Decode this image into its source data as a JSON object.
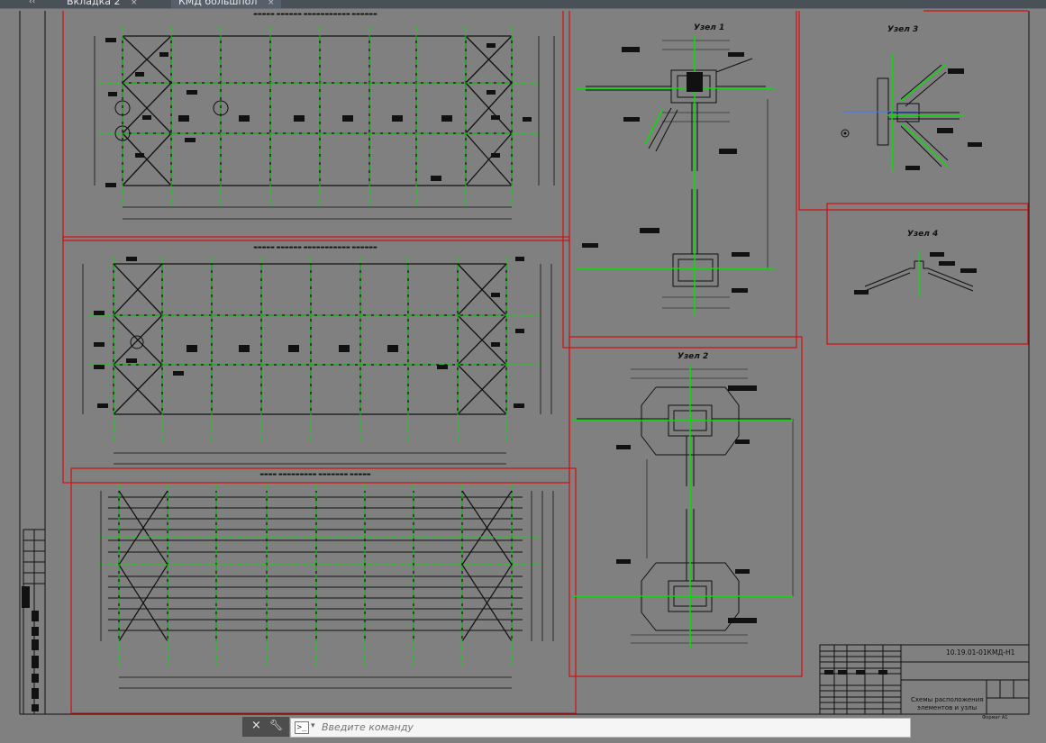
{
  "tabs": [
    {
      "label": "Вкладка 2",
      "close": "×"
    },
    {
      "label": "КМД большпол",
      "close": "×",
      "active": true
    }
  ],
  "nodes": {
    "node1": "Узел 1",
    "node2": "Узел 2",
    "node3": "Узел 3",
    "node4": "Узел 4"
  },
  "title_block": {
    "code": "10.19.01-01КМД-Н1",
    "name_line1": "Схемы расположения",
    "name_line2": "элементов и узлы",
    "format": "Формат А1"
  },
  "command_line": {
    "placeholder": "Введите команду",
    "prompt_icon": ">_",
    "close_icon": "×",
    "settings_icon": "wrench"
  },
  "colors": {
    "background": "#808080",
    "lines": "#111111",
    "frame": "#d31010",
    "axis": "#00e000",
    "centerline": "#3a7bff"
  }
}
